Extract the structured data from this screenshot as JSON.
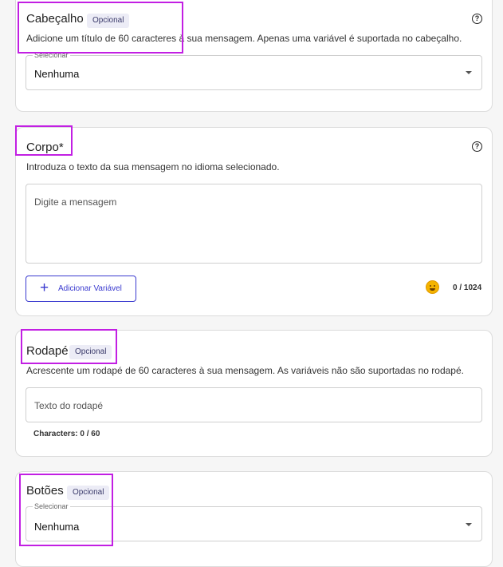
{
  "header_section": {
    "title": "Cabeçalho",
    "badge": "Opcional",
    "description": "Adicione um título de 60 caracteres à sua mensagem. Apenas uma variável é suportada no cabeçalho.",
    "select_label": "Selecionar",
    "select_value": "Nenhuma",
    "help_glyph": "?"
  },
  "body_section": {
    "title": "Corpo*",
    "description": "Introduza o texto da sua mensagem no idioma selecionado.",
    "message_placeholder": "Digite a mensagem",
    "add_variable_label": "Adicionar Variável",
    "add_variable_icon": "+",
    "char_counter": "0 / 1024",
    "help_glyph": "?"
  },
  "footer_section": {
    "title": "Rodapé",
    "badge": "Opcional",
    "description": "Acrescente um rodapé de 60 caracteres à sua mensagem. As variáveis não são suportadas no rodapé.",
    "footer_placeholder": "Texto do rodapé",
    "char_counter": "Characters: 0 / 60"
  },
  "buttons_section": {
    "title": "Botões",
    "badge": "Opcional",
    "select_label": "Selecionar",
    "select_value": "Nenhuma"
  },
  "colors": {
    "accent": "#3a3acf",
    "highlight": "#c21fe3",
    "card_border": "#dcdcdc",
    "background": "#f6f6f6"
  }
}
